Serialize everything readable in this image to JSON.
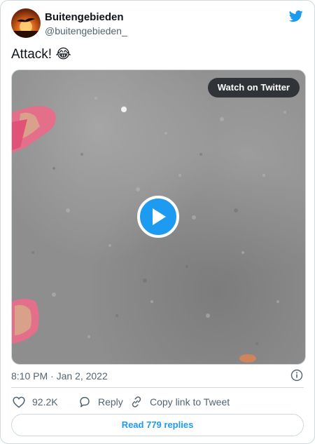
{
  "author": {
    "name": "Buitengebieden",
    "handle": "@buitengebieden_",
    "avatar_icon": "sunset-bird-avatar"
  },
  "brand_icon": "twitter-bird-icon",
  "tweet": {
    "text": "Attack!",
    "emoji": "😂"
  },
  "media": {
    "type": "video",
    "watch_label": "Watch on Twitter",
    "play_icon": "play-icon"
  },
  "timestamp": "8:10 PM · Jan 2, 2022",
  "info_icon": "info-icon",
  "actions": {
    "likes": "92.2K",
    "reply_label": "Reply",
    "copy_label": "Copy link to Tweet"
  },
  "read_replies_label": "Read 779 replies",
  "colors": {
    "accent": "#1d9bf0",
    "text": "#0f1419",
    "secondary": "#536471",
    "border": "#cfd9de"
  }
}
